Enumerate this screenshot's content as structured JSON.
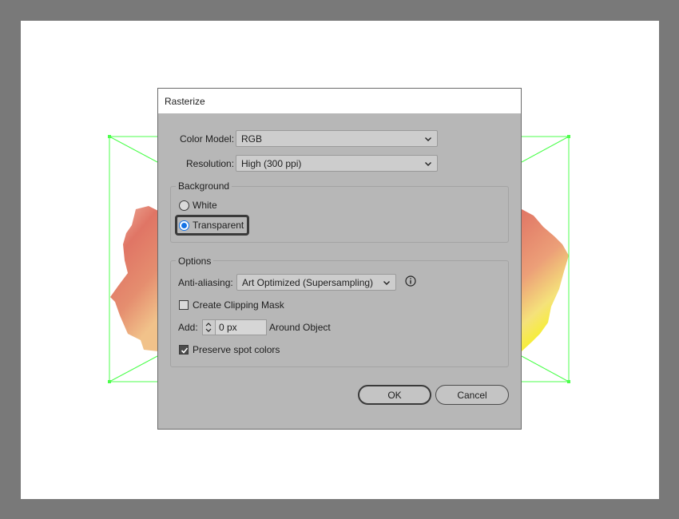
{
  "dialog": {
    "title": "Rasterize",
    "color_model": {
      "label": "Color Model:",
      "value": "RGB"
    },
    "resolution": {
      "label": "Resolution:",
      "value": "High (300 ppi)"
    },
    "background": {
      "title": "Background",
      "options": [
        "White",
        "Transparent"
      ],
      "selected": "Transparent"
    },
    "options": {
      "title": "Options",
      "anti_aliasing": {
        "label": "Anti-aliasing:",
        "value": "Art Optimized (Supersampling)"
      },
      "clipping_mask": {
        "label": "Create Clipping Mask",
        "checked": false
      },
      "add": {
        "label": "Add:",
        "value": "0 px",
        "suffix": "Around Object"
      },
      "spot_colors": {
        "label": "Preserve spot colors",
        "checked": true
      }
    },
    "buttons": {
      "ok": "OK",
      "cancel": "Cancel"
    }
  },
  "colors": {
    "canvas_bg": "#797979",
    "artboard": "#ffffff",
    "dialog_bg": "#b7b7b7",
    "selection": "#4cff4c",
    "accent": "#1473e6"
  },
  "icons": [
    "chevron-down-icon",
    "info-icon",
    "stepper-icon",
    "checkmark-icon"
  ]
}
